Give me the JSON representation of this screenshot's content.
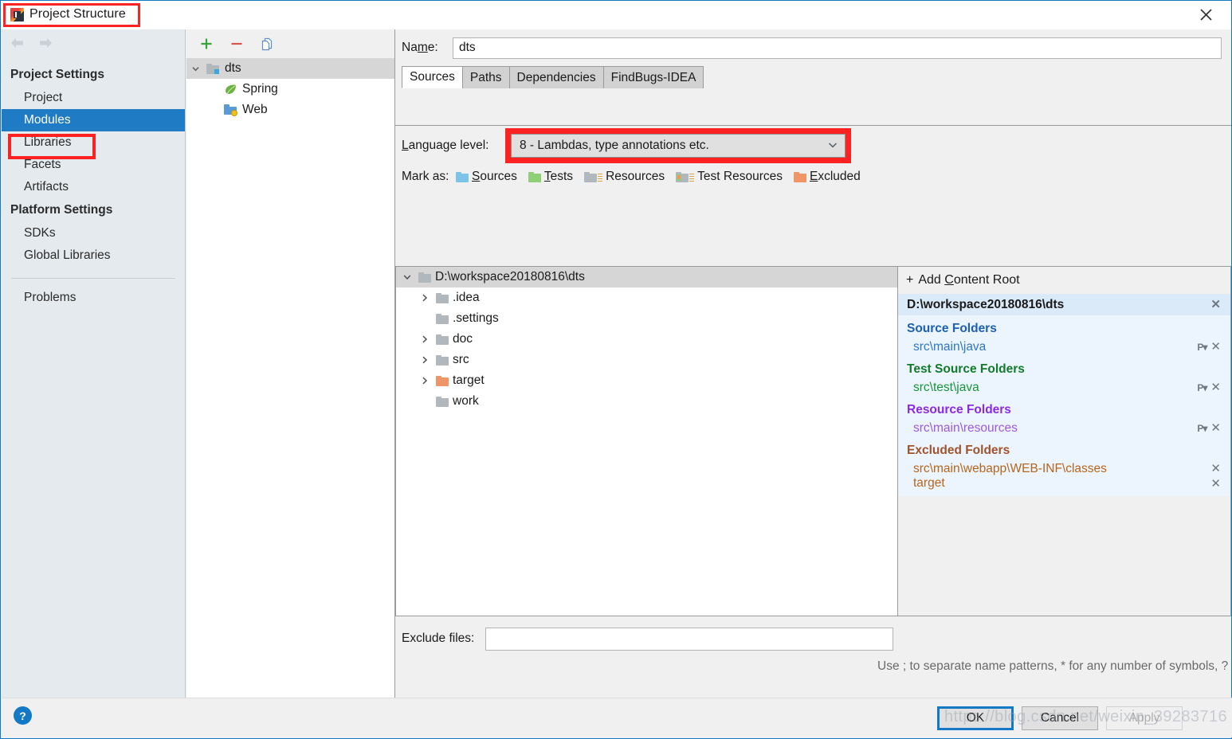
{
  "window": {
    "title": "Project Structure",
    "app_icon": "intellij-idea-icon",
    "close_icon": "close-icon"
  },
  "nav": {
    "back_icon": "arrow-left-icon",
    "forward_icon": "arrow-right-icon"
  },
  "sidebar": {
    "groups": [
      {
        "header": "Project Settings",
        "items": [
          {
            "label": "Project",
            "selected": false
          },
          {
            "label": "Modules",
            "selected": true
          },
          {
            "label": "Libraries",
            "selected": false
          },
          {
            "label": "Facets",
            "selected": false
          },
          {
            "label": "Artifacts",
            "selected": false
          }
        ]
      },
      {
        "header": "Platform Settings",
        "items": [
          {
            "label": "SDKs",
            "selected": false
          },
          {
            "label": "Global Libraries",
            "selected": false
          }
        ]
      }
    ],
    "problems": "Problems"
  },
  "modules_panel": {
    "toolbar": {
      "add_icon": "plus-icon",
      "remove_icon": "minus-icon",
      "copy_icon": "copy-icon"
    },
    "tree": [
      {
        "label": "dts",
        "icon": "module-folder-icon",
        "expanded": true,
        "selected": true,
        "level": 0
      },
      {
        "label": "Spring",
        "icon": "spring-leaf-icon",
        "level": 1
      },
      {
        "label": "Web",
        "icon": "web-facet-icon",
        "level": 1
      }
    ]
  },
  "module_editor": {
    "name_label": "Name:",
    "name_value": "dts",
    "tabs": [
      {
        "label": "Sources",
        "active": true
      },
      {
        "label": "Paths",
        "active": false
      },
      {
        "label": "Dependencies",
        "active": false
      },
      {
        "label": "FindBugs-IDEA",
        "active": false
      }
    ],
    "language_level": {
      "label": "Language level:",
      "value": "8 - Lambdas, type annotations etc.",
      "chevron_icon": "chevron-down-icon",
      "highlighted": true
    },
    "mark_as": {
      "label": "Mark as:",
      "options": [
        {
          "label": "Sources",
          "color": "#7cc3e8"
        },
        {
          "label": "Tests",
          "color": "#8fcf76"
        },
        {
          "label": "Resources",
          "color": "#b0b7bd"
        },
        {
          "label": "Test Resources",
          "color": "#b0b7bd"
        },
        {
          "label": "Excluded",
          "color": "#f09568"
        }
      ]
    },
    "folder_tree": [
      {
        "label": "D:\\workspace20180816\\dts",
        "level": 0,
        "expanded": true,
        "selected": true,
        "color": "#b0b7bd",
        "arrow": "chevron-down-icon"
      },
      {
        "label": ".idea",
        "level": 1,
        "expandable": true,
        "color": "#b0b7bd",
        "arrow": "chevron-right-icon"
      },
      {
        "label": ".settings",
        "level": 1,
        "expandable": false,
        "color": "#b0b7bd"
      },
      {
        "label": "doc",
        "level": 1,
        "expandable": true,
        "color": "#b0b7bd",
        "arrow": "chevron-right-icon"
      },
      {
        "label": "src",
        "level": 1,
        "expandable": true,
        "color": "#b0b7bd",
        "arrow": "chevron-right-icon"
      },
      {
        "label": "target",
        "level": 1,
        "expandable": true,
        "color": "#f09568",
        "arrow": "chevron-right-icon"
      },
      {
        "label": "work",
        "level": 1,
        "expandable": false,
        "color": "#b0b7bd"
      }
    ],
    "content_roots": {
      "add_label": "Add Content Root",
      "add_icon": "plus-icon",
      "root_path": "D:\\workspace20180816\\dts",
      "root_remove_icon": "close-icon",
      "groups": [
        {
          "title": "Source Folders",
          "color": "#1c5fb3",
          "entries": [
            {
              "path": "src\\main\\java",
              "color": "#2f76c7",
              "has_package_prefix": true
            }
          ]
        },
        {
          "title": "Test Source Folders",
          "color": "#137a2b",
          "entries": [
            {
              "path": "src\\test\\java",
              "color": "#19943a",
              "has_package_prefix": true
            }
          ]
        },
        {
          "title": "Resource Folders",
          "color": "#8a2be2",
          "entries": [
            {
              "path": "src\\main\\resources",
              "color": "#9b59e0",
              "has_package_prefix": true
            }
          ]
        },
        {
          "title": "Excluded Folders",
          "color": "#a0522d",
          "entries": [
            {
              "path": "src\\main\\webapp\\WEB-INF\\classes",
              "color": "#b5651d",
              "has_package_prefix": false
            },
            {
              "path": "target",
              "color": "#b5651d",
              "has_package_prefix": false
            }
          ]
        }
      ]
    },
    "exclude_files": {
      "label": "Exclude files:",
      "value": "",
      "placeholder": "",
      "hint": "Use ; to separate name patterns, * for any number of symbols, ? for one."
    }
  },
  "footer": {
    "help_icon": "help-icon",
    "help_label": "?",
    "ok_label": "OK",
    "cancel_label": "Cancel",
    "apply_label": "Apply",
    "watermark": "https://blog.csdn.net/weixin_39283716"
  },
  "colors": {
    "accent": "#1479c4",
    "selection": "#1e7bc4",
    "highlight_box": "#ff2222",
    "sidebar_bg": "#e5eaee"
  }
}
